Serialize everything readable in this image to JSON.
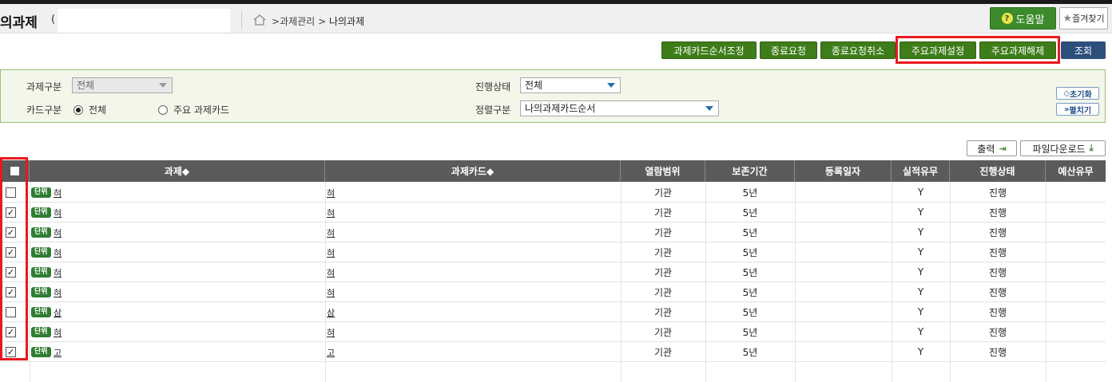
{
  "header": {
    "title": "의과제",
    "title_paren": "(",
    "breadcrumb": {
      "sep1": ">",
      "item1": "과제관리",
      "sep2": ">",
      "current": "나의과제"
    },
    "help_label": "도움말",
    "fav_label": "즐겨찾기"
  },
  "actions": {
    "reorder": "과제카드순서조정",
    "end_request": "종료요청",
    "end_cancel": "종료요청취소",
    "main_set": "주요과제설정",
    "main_unset": "주요과제해제",
    "search": "조회"
  },
  "filter": {
    "task_type_label": "과제구분",
    "task_type_value": "전체",
    "card_type_label": "카드구분",
    "card_opt_all": "전체",
    "card_opt_main": "주요 과제카드",
    "card_selected": "전체",
    "status_label": "진행상태",
    "status_value": "전체",
    "sort_label": "정렬구분",
    "sort_value": "나의과제카드순서",
    "reset_label": "초기화",
    "expand_label": "펼치기"
  },
  "tools": {
    "print_label": "출력",
    "download_label": "파일다운로드"
  },
  "table": {
    "headers": [
      "과제◆",
      "과제카드◆",
      "열람범위",
      "보존기간",
      "등록일자",
      "실적유무",
      "진행상태",
      "예산유무"
    ],
    "rows": [
      {
        "checked": false,
        "check_mark": "",
        "badge": "단위",
        "task": "혀",
        "card": "혀",
        "scope": "기관",
        "period": "5년",
        "date": "",
        "perf": "Y",
        "status": "진행",
        "budget": ""
      },
      {
        "checked": true,
        "check_mark": "✓",
        "badge": "단위",
        "task": "혀",
        "card": "혀",
        "scope": "기관",
        "period": "5년",
        "date": "",
        "perf": "Y",
        "status": "진행",
        "budget": ""
      },
      {
        "checked": true,
        "check_mark": "✓",
        "badge": "단위",
        "task": "혀",
        "card": "혀",
        "scope": "기관",
        "period": "5년",
        "date": "",
        "perf": "Y",
        "status": "진행",
        "budget": ""
      },
      {
        "checked": true,
        "check_mark": "✓",
        "badge": "단위",
        "task": "혀",
        "card": "혀",
        "scope": "기관",
        "period": "5년",
        "date": "",
        "perf": "Y",
        "status": "진행",
        "budget": ""
      },
      {
        "checked": true,
        "check_mark": "✓",
        "badge": "단위",
        "task": "혀",
        "card": "혀",
        "scope": "기관",
        "period": "5년",
        "date": "",
        "perf": "Y",
        "status": "진행",
        "budget": ""
      },
      {
        "checked": true,
        "check_mark": "✓",
        "badge": "단위",
        "task": "혀",
        "card": "혀",
        "scope": "기관",
        "period": "5년",
        "date": "",
        "perf": "Y",
        "status": "진행",
        "budget": ""
      },
      {
        "checked": false,
        "check_mark": "",
        "badge": "단위",
        "task": "삼",
        "card": "삼",
        "scope": "기관",
        "period": "5년",
        "date": "",
        "perf": "Y",
        "status": "진행",
        "budget": ""
      },
      {
        "checked": true,
        "check_mark": "✓",
        "badge": "단위",
        "task": "혀",
        "card": "혀",
        "scope": "기관",
        "period": "5년",
        "date": "",
        "perf": "Y",
        "status": "진행",
        "budget": ""
      },
      {
        "checked": true,
        "check_mark": "✓",
        "badge": "단위",
        "task": "고",
        "card": "고",
        "scope": "기관",
        "period": "5년",
        "date": "",
        "perf": "Y",
        "status": "진행",
        "budget": ""
      }
    ]
  },
  "colors": {
    "green_button": "#3e7d1a",
    "blue_button": "#2d4f7c",
    "highlight": "#e8191f",
    "table_header": "#5b5b5b"
  }
}
